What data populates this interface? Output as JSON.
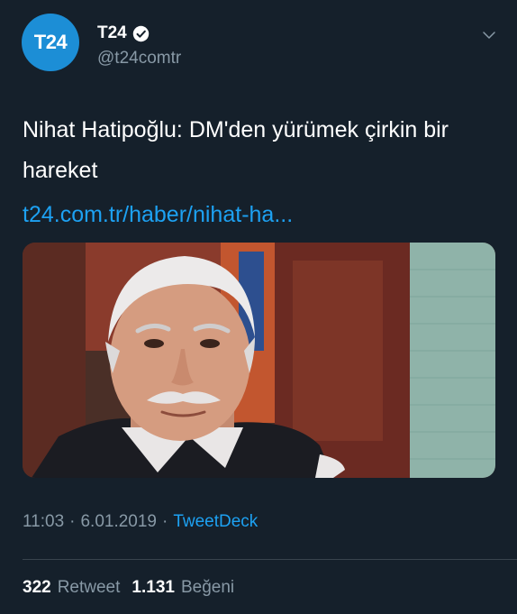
{
  "account": {
    "avatar_text": "T24",
    "display_name": "T24",
    "handle": "@t24comtr",
    "verified": true
  },
  "tweet": {
    "text": "Nihat Hatipoğlu: DM'den yürümek çirkin bir hareket",
    "link": "t24.com.tr/haber/nihat-ha...",
    "time": "11:03",
    "separator": "·",
    "date": "6.01.2019",
    "source": "TweetDeck"
  },
  "stats": {
    "retweet_count": "322",
    "retweet_label": "Retweet",
    "like_count": "1.131",
    "like_label": "Beğeni"
  },
  "colors": {
    "background": "#15202b",
    "accent": "#1da1f2",
    "avatar": "#1c8ed6",
    "secondary_text": "#8899a6"
  },
  "icons": [
    "verified-icon",
    "chevron-down-icon"
  ]
}
